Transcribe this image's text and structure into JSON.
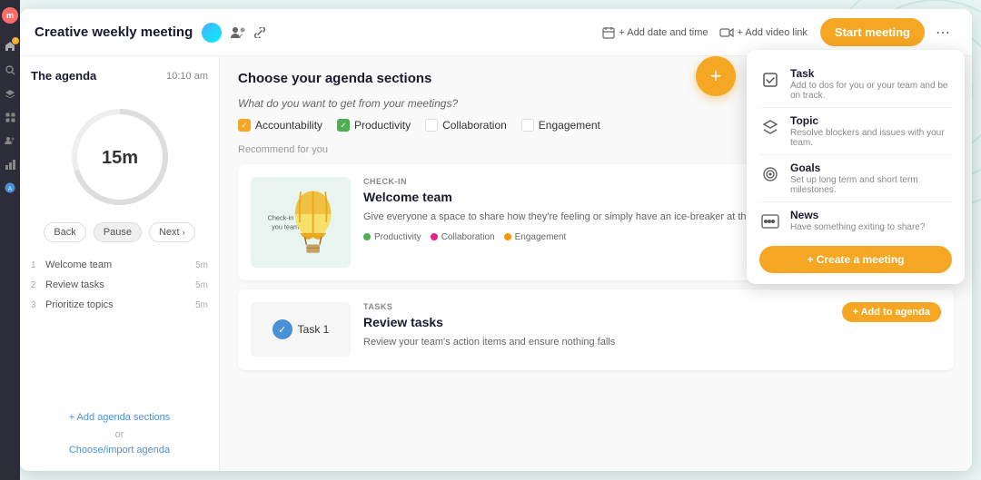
{
  "sidebar": {
    "logo": "m",
    "icons": [
      "home",
      "search",
      "layers",
      "grid",
      "people",
      "chart",
      "settings"
    ]
  },
  "header": {
    "title": "Creative weekly meeting",
    "add_date_label": "+ Add date and time",
    "add_video_label": "+ Add video link",
    "start_btn": "Start meeting",
    "more_icon": "⋯"
  },
  "agenda": {
    "title": "The agenda",
    "time": "10:10 am",
    "timer": "15m",
    "back_label": "Back",
    "pause_label": "Pause",
    "next_label": "Next",
    "items": [
      {
        "num": "1",
        "label": "Welcome team",
        "time": "5m"
      },
      {
        "num": "2",
        "label": "Review tasks",
        "time": "5m"
      },
      {
        "num": "3",
        "label": "Prioritize topics",
        "time": "5m"
      }
    ],
    "add_sections_label": "+ Add agenda sections",
    "or_label": "or",
    "choose_import_label": "Choose/import agenda"
  },
  "sections": {
    "title": "Choose your agenda sections",
    "question": "What do you want to get from your meetings?",
    "checkboxes": [
      {
        "label": "Accountability",
        "checked": "yellow"
      },
      {
        "label": "Productivity",
        "checked": "green"
      },
      {
        "label": "Collaboration",
        "checked": "none"
      },
      {
        "label": "Engagement",
        "checked": "none"
      }
    ],
    "recommend_label": "Recommend for you",
    "cards": [
      {
        "tag": "CHECK-IN",
        "title": "Welcome team",
        "desc": "Give everyone a space to share how they're feeling or simply have an ice-breaker at the beginning of your meeting.",
        "visual_text": "Check-in with you team!",
        "tags": [
          "Productivity",
          "Collaboration",
          "Engagement"
        ]
      },
      {
        "tag": "TASKS",
        "title": "Review tasks",
        "desc": "Review your team's action items and ensure nothing falls",
        "has_add_btn": true,
        "add_btn_label": "+ Add to agenda"
      }
    ]
  },
  "popup": {
    "items": [
      {
        "icon": "task",
        "title": "Task",
        "desc": "Add to dos for you or your team and be on track."
      },
      {
        "icon": "topic",
        "title": "Topic",
        "desc": "Resolve blockers and issues with your team."
      },
      {
        "icon": "goals",
        "title": "Goals",
        "desc": "Set up long term and short term milestones."
      },
      {
        "icon": "news",
        "title": "News",
        "desc": "Have something exiting to share?"
      }
    ],
    "create_btn_label": "+ Create a meeting"
  },
  "fab": {
    "label": "+"
  }
}
